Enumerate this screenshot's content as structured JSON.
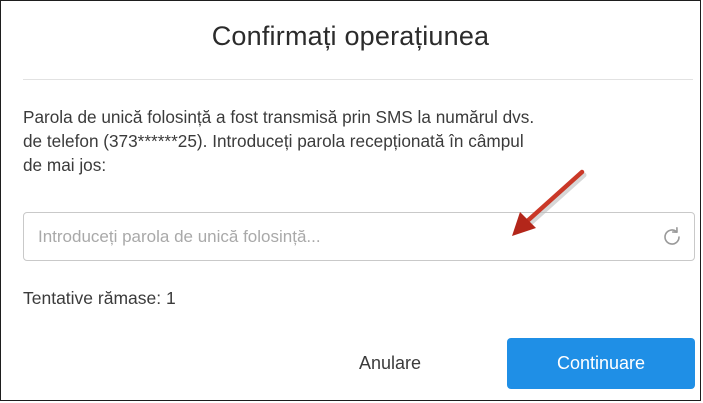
{
  "dialog": {
    "title": "Confirmați operațiunea",
    "message": "Parola de unică folosință a fost transmisă prin SMS la numărul dvs.\nde telefon (373******25). Introduceți parola recepționată în câmpul\nde mai jos:",
    "otp_input": {
      "value": "",
      "placeholder": "Introduceți parola de unică folosință..."
    },
    "refresh_icon": "refresh-icon",
    "attempts_label": "Tentative rămase: 1",
    "cancel_label": "Anulare",
    "continue_label": "Continuare"
  },
  "colors": {
    "accent": "#1f8fe6",
    "annotation_arrow": "#c8321f",
    "border": "#1e1e1e",
    "text": "#3b3b3b"
  }
}
